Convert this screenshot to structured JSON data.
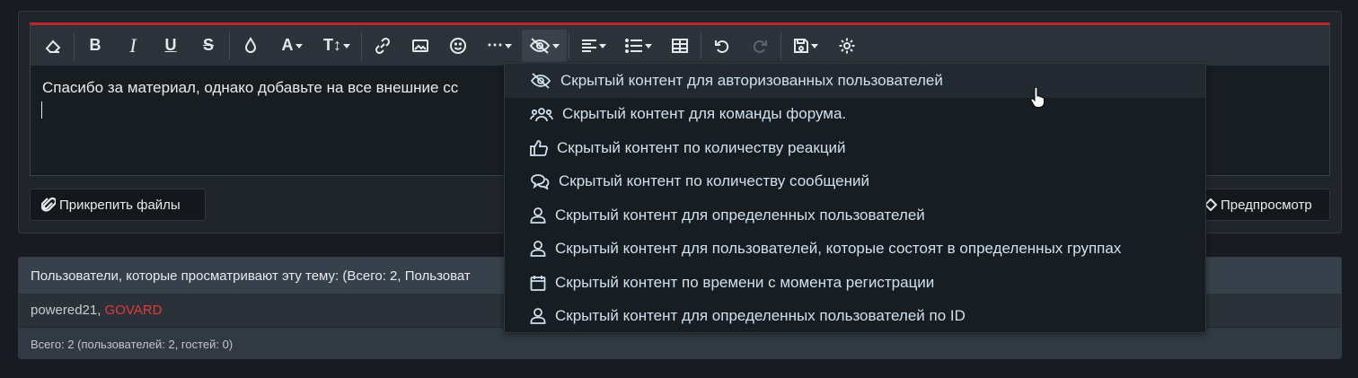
{
  "editor": {
    "text": "Спасибо за материал, однако добавьте на все внешние сс",
    "toolbar": [
      {
        "icon": "eraser-icon",
        "type": "icon"
      },
      {
        "sep": true
      },
      {
        "icon": "bold-icon",
        "type": "text",
        "glyph": "B"
      },
      {
        "icon": "italic-icon",
        "type": "text",
        "glyph": "I"
      },
      {
        "icon": "underline-icon",
        "type": "text",
        "glyph": "U"
      },
      {
        "icon": "strikethrough-icon",
        "type": "text",
        "glyph": "S"
      },
      {
        "sep": true
      },
      {
        "icon": "color-drop-icon",
        "type": "icon"
      },
      {
        "icon": "font-family-icon",
        "type": "text",
        "glyph": "A"
      },
      {
        "icon": "font-size-icon",
        "type": "text",
        "glyph": "T↕"
      },
      {
        "sep": true
      },
      {
        "icon": "link-icon",
        "type": "icon"
      },
      {
        "icon": "image-icon",
        "type": "icon"
      },
      {
        "icon": "smiley-icon",
        "type": "icon"
      },
      {
        "icon": "more-icon",
        "type": "text",
        "glyph": "⋯"
      },
      {
        "icon": "hide-icon",
        "type": "icon"
      },
      {
        "sep": true
      },
      {
        "icon": "align-icon",
        "type": "icon"
      },
      {
        "icon": "list-icon",
        "type": "icon"
      },
      {
        "icon": "table-icon",
        "type": "icon"
      },
      {
        "sep": true
      },
      {
        "icon": "undo-icon",
        "type": "icon"
      },
      {
        "icon": "redo-icon",
        "type": "icon"
      },
      {
        "sep": true
      },
      {
        "icon": "save-draft-icon",
        "type": "icon"
      },
      {
        "icon": "settings-gear-icon",
        "type": "icon"
      }
    ]
  },
  "buttons": {
    "attach_label": "Прикрепить файлы",
    "preview_label": "Предпросмотр"
  },
  "users_panel": {
    "heading": "Пользователи, которые просматривают эту тему: (Всего: 2, Пользоват",
    "user1": "powered21",
    "comma": ", ",
    "user2": "GOVARD",
    "footer": "Всего: 2 (пользователей: 2, гостей: 0)"
  },
  "hide_menu": {
    "items": [
      {
        "label": "Скрытый контент для авторизованных пользователей",
        "icon": "eye-slash-icon"
      },
      {
        "label": "Скрытый контент для команды форума.",
        "icon": "users-group-icon"
      },
      {
        "label": "Скрытый контент по количеству реакций",
        "icon": "thumbs-up-icon"
      },
      {
        "label": "Скрытый контент по количеству сообщений",
        "icon": "comments-icon"
      },
      {
        "label": "Скрытый контент для определенных пользователей",
        "icon": "user-icon"
      },
      {
        "label": "Скрытый контент для пользователей, которые состоят в определенных группах",
        "icon": "user-icon"
      },
      {
        "label": "Скрытый контент по времени с момента регистрации",
        "icon": "calendar-icon"
      },
      {
        "label": "Скрытый контент для определенных пользователей по ID",
        "icon": "user-icon"
      }
    ]
  }
}
